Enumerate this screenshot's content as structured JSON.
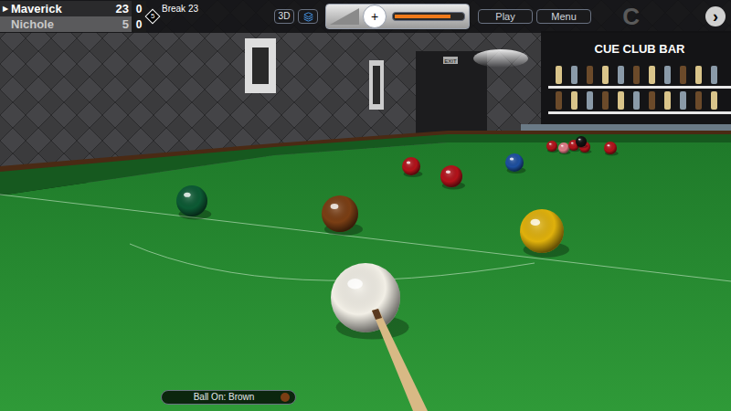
{
  "scoreboard": {
    "active_marker": "▶",
    "players": [
      {
        "name": "Maverick",
        "score": "23",
        "frames": "0",
        "selected": true
      },
      {
        "name": "Nichole",
        "score": "5",
        "frames": "0",
        "selected": false
      }
    ],
    "best_of": "5",
    "break": "Break 23"
  },
  "toolbar": {
    "view_button": "3D",
    "spin_mark": "+",
    "power": {
      "level": 0.82
    },
    "buttons": [
      "Play",
      "Menu"
    ],
    "logo": "C",
    "next": "›"
  },
  "scene": {
    "bar_sign": "CUE CLUB BAR",
    "exit_sign": "EXIT",
    "balls": [
      {
        "color": "#b3121a"
      },
      {
        "color": "#b3121a"
      },
      {
        "color": "#1d4fa0"
      },
      {
        "color": "#0c5a34"
      },
      {
        "color": "#7a3e14"
      },
      {
        "color": "#e0b10c"
      },
      {
        "color": "#b3121a"
      },
      {
        "color": "#e07a86"
      },
      {
        "color": "#b3121a"
      },
      {
        "color": "#b3121a"
      },
      {
        "color": "#111111"
      },
      {
        "color": "#b3121a"
      },
      {
        "color": "#f2efe6"
      }
    ]
  },
  "status": {
    "ball_on": "Ball On: Brown",
    "ball_on_color": "#7a3e14"
  }
}
